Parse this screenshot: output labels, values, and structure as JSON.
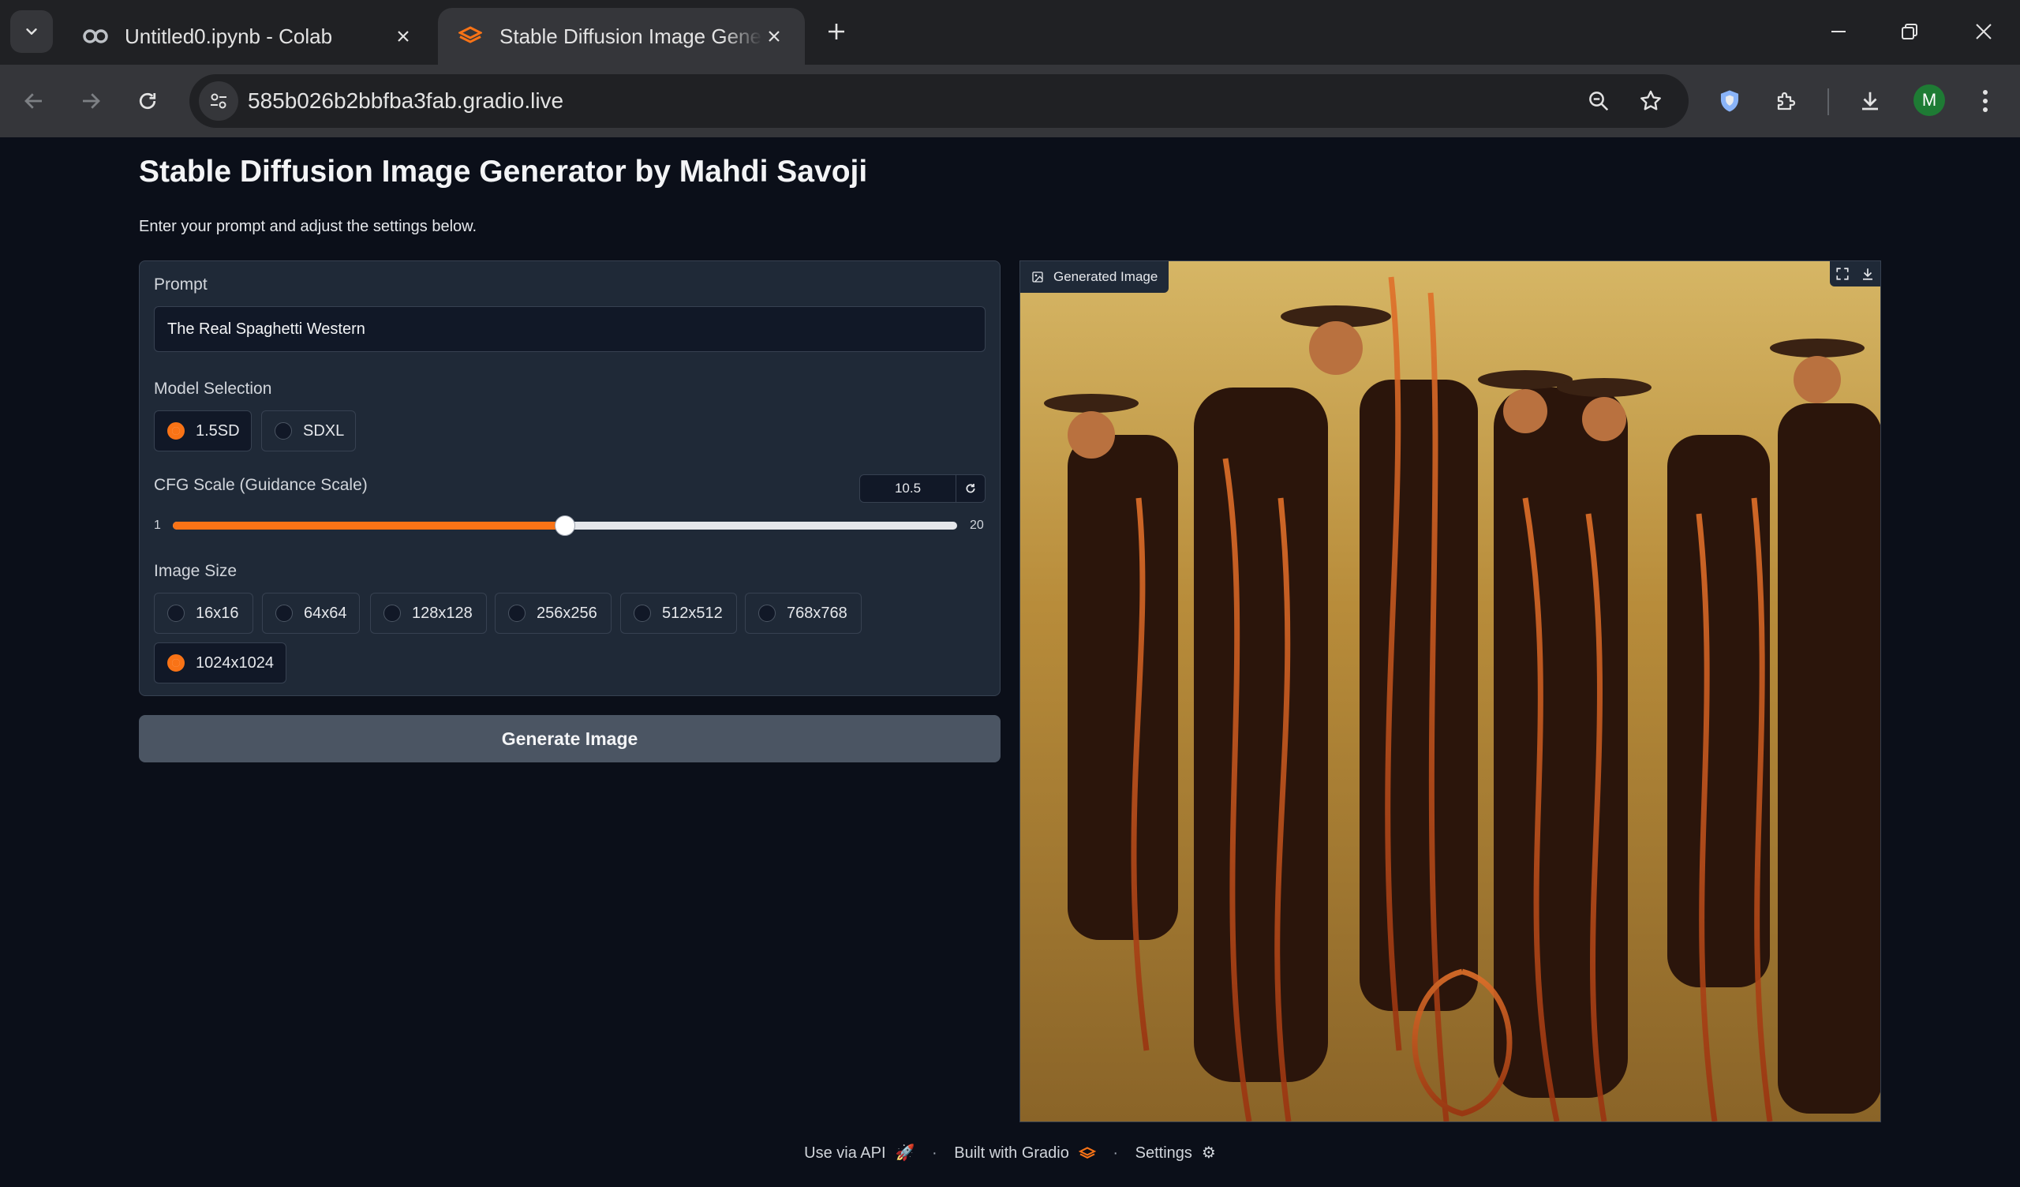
{
  "browser": {
    "tabs": [
      {
        "title": "Untitled0.ipynb - Colab",
        "icon": "colab-icon",
        "active": false
      },
      {
        "title": "Stable Diffusion Image Generator",
        "icon": "gradio-icon",
        "active": true
      }
    ],
    "url": "585b026b2bbfba3fab.gradio.live",
    "profile_initial": "M",
    "accent_color": "#f97316"
  },
  "app": {
    "title": "Stable Diffusion Image Generator by Mahdi Savoji",
    "description": "Enter your prompt and adjust the settings below."
  },
  "form": {
    "prompt_label": "Prompt",
    "prompt_value": "The Real Spaghetti Western",
    "model_label": "Model Selection",
    "model_options": [
      "1.5SD",
      "SDXL"
    ],
    "model_selected": "1.5SD",
    "cfg_label": "CFG Scale (Guidance Scale)",
    "cfg_value": "10.5",
    "cfg_min": "1",
    "cfg_max": "20",
    "size_label": "Image Size",
    "size_options": [
      "16x16",
      "64x64",
      "128x128",
      "256x256",
      "512x512",
      "768x768",
      "1024x1024"
    ],
    "size_selected": "1024x1024",
    "generate_label": "Generate Image"
  },
  "output": {
    "label": "Generated Image"
  },
  "footer": {
    "api": "Use via API",
    "built": "Built with Gradio",
    "settings": "Settings"
  }
}
